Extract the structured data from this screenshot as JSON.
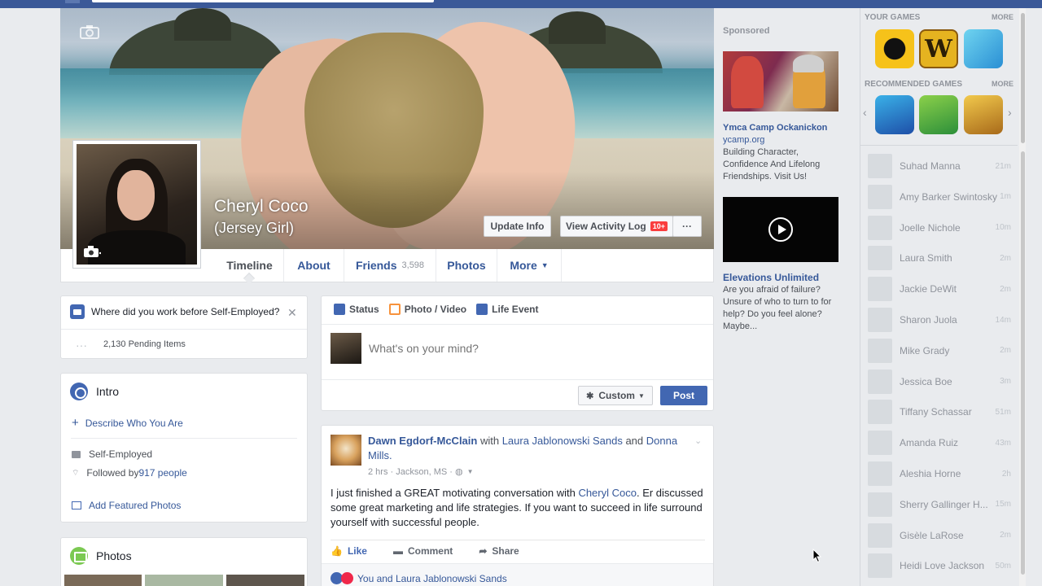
{
  "cover": {
    "name": "Cheryl Coco",
    "nickname": "(Jersey Girl)",
    "update_info": "Update Info",
    "activity_log": "View Activity Log",
    "activity_badge": "10+",
    "more_dots": "···"
  },
  "tabs": {
    "timeline": "Timeline",
    "about": "About",
    "friends": "Friends",
    "friends_count": "3,598",
    "photos": "Photos",
    "more": "More"
  },
  "work_prompt": {
    "question": "Where did you work before Self-Employed?",
    "pending": "2,130 Pending Items",
    "dots": "···"
  },
  "intro": {
    "title": "Intro",
    "describe": "Describe Who You Are",
    "employer": "Self-Employed",
    "followed_prefix": "Followed by ",
    "followed_count": "917 people",
    "featured": "Add Featured Photos"
  },
  "photos_card": {
    "title": "Photos"
  },
  "composer": {
    "status": "Status",
    "photo_video": "Photo / Video",
    "life_event": "Life Event",
    "placeholder": "What's on your mind?",
    "privacy": "Custom",
    "post": "Post"
  },
  "post": {
    "author": "Dawn Egdorf-McClain",
    "with": " with ",
    "tagged1": "Laura Jablonowski Sands",
    "and": " and ",
    "tagged2": "Donna Mills",
    "period": ".",
    "meta": "2 hrs · Jackson, MS · ",
    "text_before": "I just finished a GREAT motivating conversation with ",
    "mention": "Cheryl Coco",
    "text_after": ". Er discussed some great marketing and life strategies. If you want to succeed in life surround yourself with successful people.",
    "like": "Like",
    "comment": "Comment",
    "share": "Share",
    "reactions": "You and Laura Jablonowski Sands"
  },
  "ads": {
    "sponsored": "Sponsored",
    "ad1_title": "Ymca Camp Ockanickon",
    "ad1_url": "ycamp.org",
    "ad1_text": "Building Character, Confidence And Lifelong Friendships. Visit Us!",
    "ad2_title": "Elevations Unlimited",
    "ad2_text": "Are you afraid of failure? Unsure of who to turn to for help? Do you feel alone? Maybe..."
  },
  "games": {
    "your_games": "YOUR GAMES",
    "recommended": "RECOMMENDED GAMES",
    "more": "MORE"
  },
  "chat": [
    {
      "name": "Suhad Manna",
      "time": "21m"
    },
    {
      "name": "Amy Barker Swintosky",
      "time": "1m"
    },
    {
      "name": "Joelle Nichole",
      "time": "10m"
    },
    {
      "name": "Laura Smith",
      "time": "2m"
    },
    {
      "name": "Jackie DeWit",
      "time": "2m"
    },
    {
      "name": "Sharon Juola",
      "time": "14m"
    },
    {
      "name": "Mike Grady",
      "time": "2m"
    },
    {
      "name": "Jessica Boe",
      "time": "3m"
    },
    {
      "name": "Tiffany Schassar",
      "time": "51m"
    },
    {
      "name": "Amanda Ruiz",
      "time": "43m"
    },
    {
      "name": "Aleshia Horne",
      "time": "2h"
    },
    {
      "name": "Sherry Gallinger H...",
      "time": "15m"
    },
    {
      "name": "Gisèle LaRose",
      "time": "2m"
    },
    {
      "name": "Heidi Love Jackson",
      "time": "50m"
    }
  ]
}
